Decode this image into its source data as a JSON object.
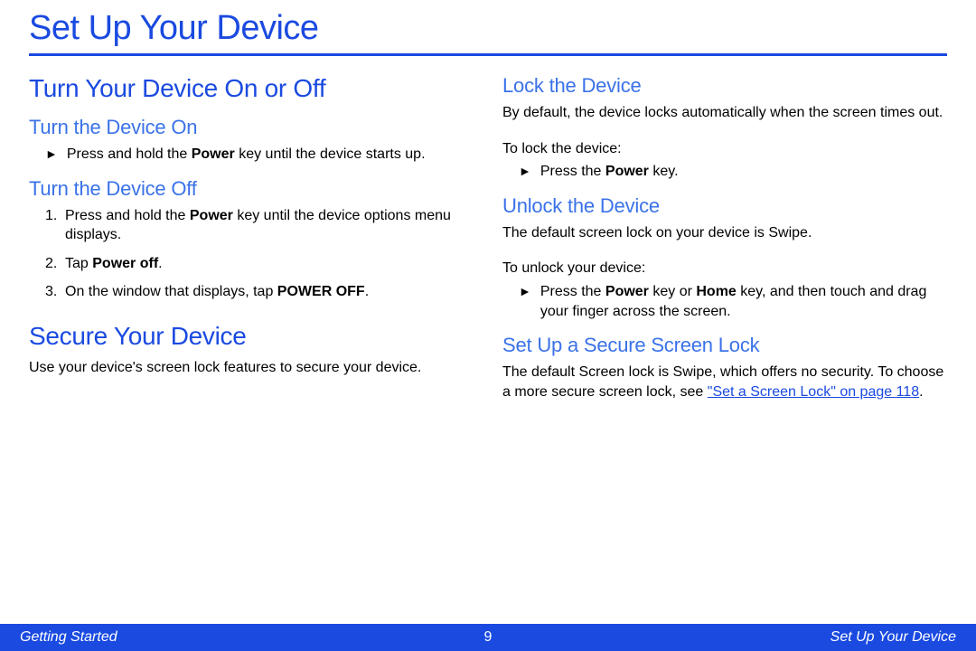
{
  "title": "Set Up Your Device",
  "left": {
    "section1_heading": "Turn Your Device On or Off",
    "sub1_heading": "Turn the Device On",
    "sub1_arrow_pre": "Press and hold the ",
    "sub1_arrow_bold": "Power",
    "sub1_arrow_post": " key until the device starts up.",
    "sub2_heading": "Turn the Device Off",
    "step1_pre": "Press and hold the ",
    "step1_bold": "Power",
    "step1_post": " key until the device options menu displays.",
    "step2_pre": "Tap ",
    "step2_bold": "Power off",
    "step2_post": ".",
    "step3_pre": "On the window that displays, tap ",
    "step3_bold": "POWER OFF",
    "step3_post": ".",
    "section2_heading": "Secure Your Device",
    "section2_body": "Use your device's screen lock features to secure your device."
  },
  "right": {
    "sub1_heading": "Lock the Device",
    "sub1_body": "By default, the device locks automatically when the screen times out.",
    "sub1_lead": "To lock the device:",
    "sub1_arrow_pre": "Press the ",
    "sub1_arrow_bold": "Power",
    "sub1_arrow_post": " key.",
    "sub2_heading": "Unlock the Device",
    "sub2_body": "The default screen lock on your device is Swipe.",
    "sub2_lead": "To unlock your device:",
    "sub2_arrow_pre": "Press the ",
    "sub2_arrow_bold1": "Power",
    "sub2_arrow_mid": " key or ",
    "sub2_arrow_bold2": "Home",
    "sub2_arrow_post": " key, and then touch and drag your finger across the screen.",
    "sub3_heading": "Set Up a Secure Screen Lock",
    "sub3_body_pre": "The default Screen lock is Swipe, which offers no security. To choose a more secure screen lock, see ",
    "sub3_xref": "\"Set a Screen Lock\" on page 118",
    "sub3_body_post": "."
  },
  "footer": {
    "left": "Getting Started",
    "center": "9",
    "right": "Set Up Your Device"
  }
}
